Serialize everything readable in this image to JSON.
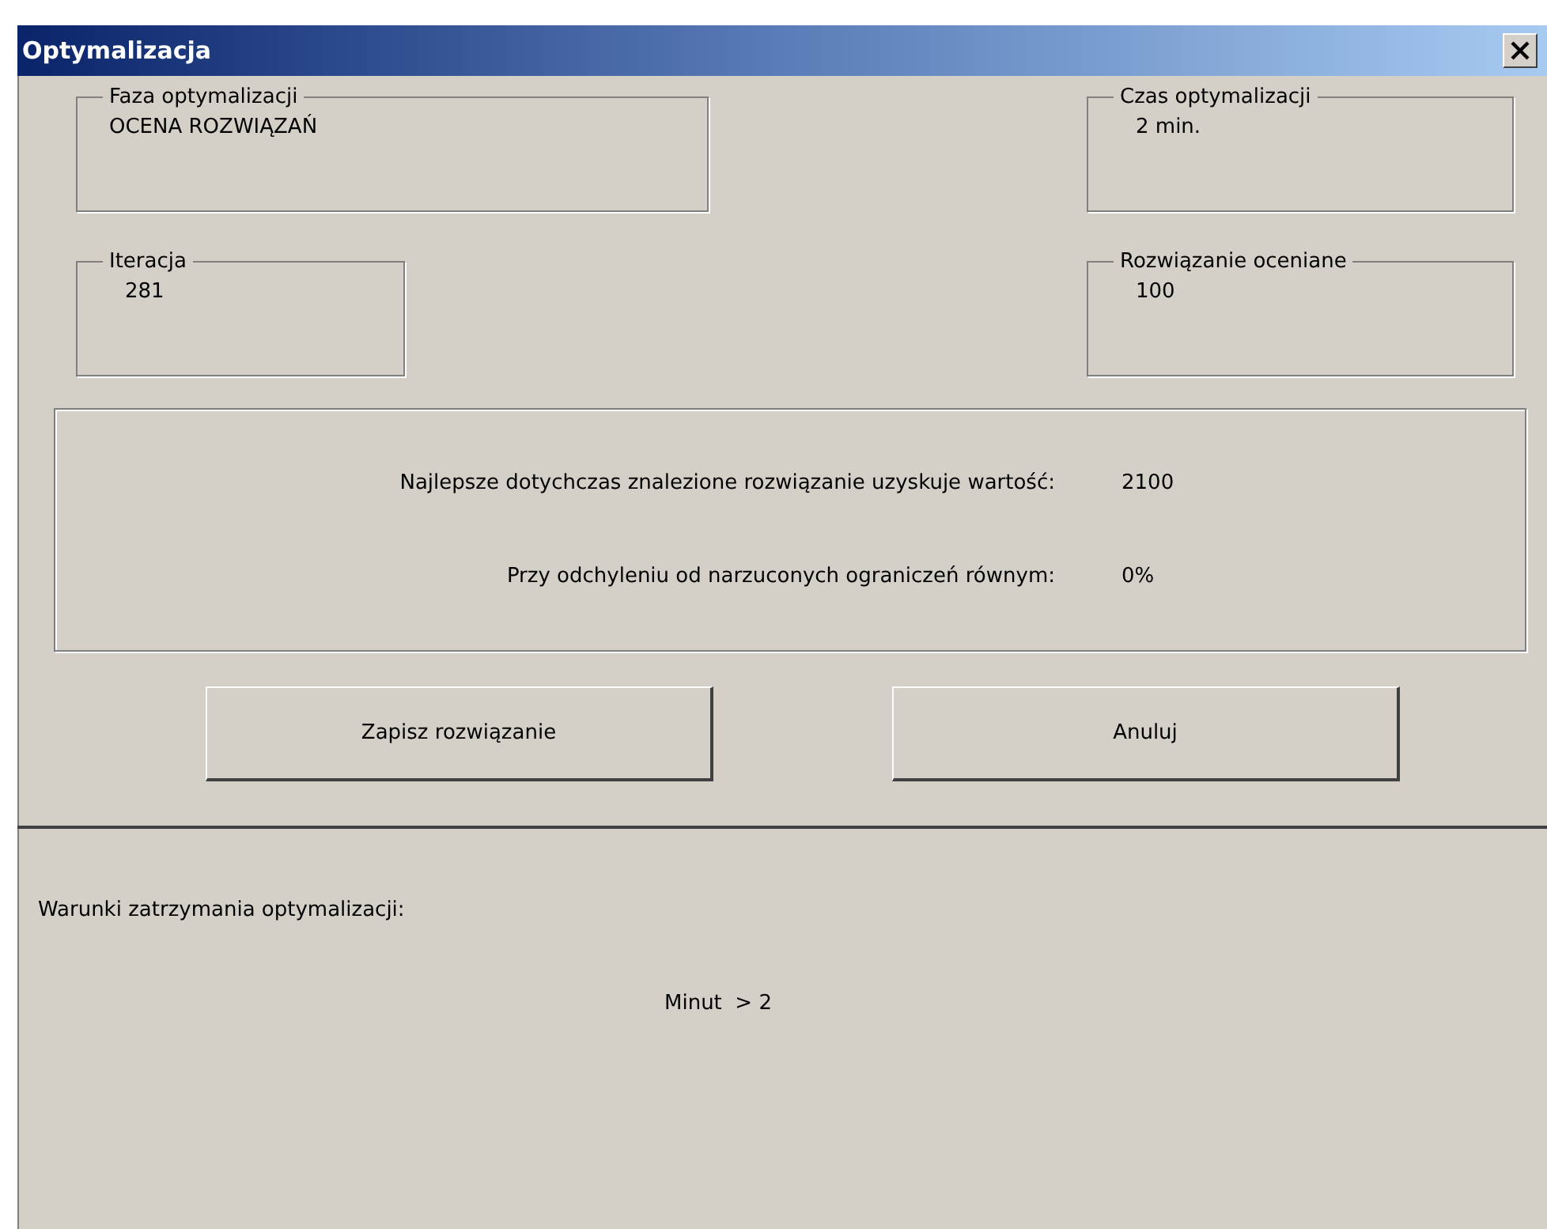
{
  "window": {
    "title": "Optymalizacja"
  },
  "groups": [
    {
      "label": "Faza optymalizacji",
      "value": "OCENA ROZWIĄZAŃ"
    },
    {
      "label": "Czas optymalizacji",
      "value": "2 min."
    },
    {
      "label": "Iteracja",
      "value": "281"
    },
    {
      "label": "Rozwiązanie oceniane",
      "value": "100"
    }
  ],
  "results": [
    {
      "label": "Najlepsze dotychczas znalezione rozwiązanie uzyskuje wartość:",
      "value": "2100"
    },
    {
      "label": "Przy odchyleniu od narzuconych ograniczeń równym:",
      "value": "0%"
    }
  ],
  "buttons": [
    "Zapisz rozwiązanie",
    "Anuluj"
  ],
  "stop_conditions": {
    "title": "Warunki zatrzymania optymalizacji:",
    "items": [
      "Minut  > 2"
    ]
  }
}
